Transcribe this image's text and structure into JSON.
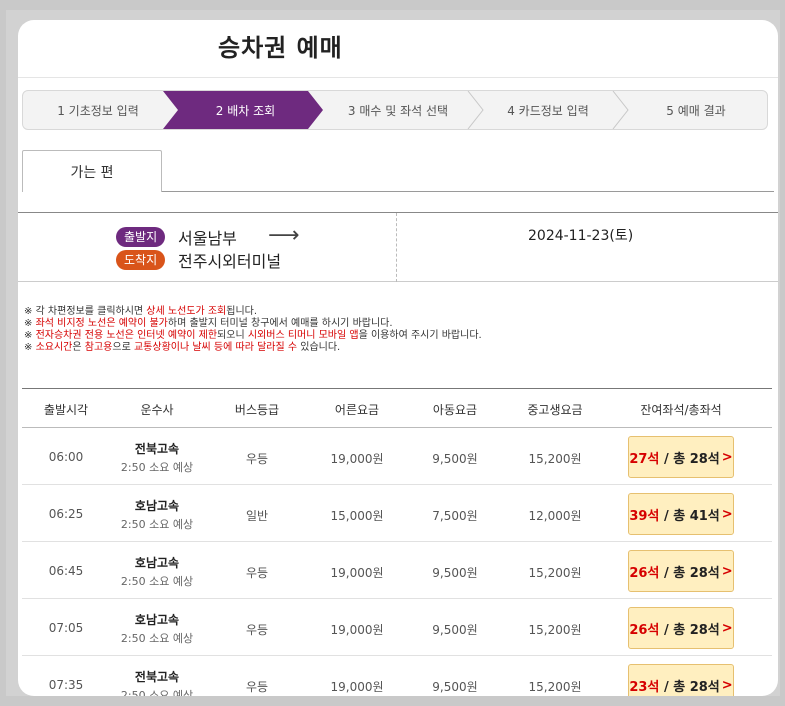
{
  "page": {
    "title": "승차권 예매"
  },
  "steps": [
    {
      "label": "1 기초정보 입력",
      "active": false
    },
    {
      "label": "2 배차 조회",
      "active": true
    },
    {
      "label": "3 매수 및 좌석 선택",
      "active": false
    },
    {
      "label": "4 카드정보 입력",
      "active": false
    },
    {
      "label": "5 예매 결과",
      "active": false
    }
  ],
  "tab": {
    "label": "가는 편"
  },
  "route": {
    "departure_badge": "출발지",
    "departure": "서울남부",
    "arrival_badge": "도착지",
    "arrival": "전주시외터미널",
    "arrow": "⟶",
    "date": "2024-11-23(토)"
  },
  "notes": [
    {
      "parts": [
        "※ 각 차편정보를 클릭하시면 ",
        "상세 노선도가 조회",
        "됩니다."
      ]
    },
    {
      "parts": [
        "※ ",
        "좌석 비지정 노선은 예약이 불가",
        "하며 출발지 터미널 창구에서 예매를 하시기 바랍니다."
      ]
    },
    {
      "parts": [
        "※ ",
        "전자승차권 전용 노선은 인터넷 예약이 제한",
        "되오니 ",
        "시외버스 티머니 모바일 앱",
        "을 이용하여 주시기 바랍니다."
      ]
    },
    {
      "parts": [
        "※ ",
        "소요시간",
        "은 ",
        "참고용",
        "으로 ",
        "교통상황이나 날씨 등에 따라 달라질 수",
        " 있습니다."
      ]
    }
  ],
  "table": {
    "headers": [
      "출발시각",
      "운수사",
      "버스등급",
      "어른요금",
      "아동요금",
      "중고생요금",
      "잔여좌석/총좌석"
    ],
    "rows": [
      {
        "time": "06:00",
        "company": "전북고속",
        "duration": "2:50 소요 예상",
        "grade": "우등",
        "adult": "19,000원",
        "child": "9,500원",
        "youth": "15,200원",
        "seats_avail": "27석",
        "seats_total": "/ 총 28석",
        "chev": ">"
      },
      {
        "time": "06:25",
        "company": "호남고속",
        "duration": "2:50 소요 예상",
        "grade": "일반",
        "adult": "15,000원",
        "child": "7,500원",
        "youth": "12,000원",
        "seats_avail": "39석",
        "seats_total": "/ 총 41석",
        "chev": ">"
      },
      {
        "time": "06:45",
        "company": "호남고속",
        "duration": "2:50 소요 예상",
        "grade": "우등",
        "adult": "19,000원",
        "child": "9,500원",
        "youth": "15,200원",
        "seats_avail": "26석",
        "seats_total": "/ 총 28석",
        "chev": ">"
      },
      {
        "time": "07:05",
        "company": "호남고속",
        "duration": "2:50 소요 예상",
        "grade": "우등",
        "adult": "19,000원",
        "child": "9,500원",
        "youth": "15,200원",
        "seats_avail": "26석",
        "seats_total": "/ 총 28석",
        "chev": ">"
      },
      {
        "time": "07:35",
        "company": "전북고속",
        "duration": "2:50 소요 예상",
        "grade": "우등",
        "adult": "19,000원",
        "child": "9,500원",
        "youth": "15,200원",
        "seats_avail": "23석",
        "seats_total": "/ 총 28석",
        "chev": ">"
      }
    ]
  },
  "colors": {
    "active_step": "#6e2a7f",
    "departure_badge": "#6e2a7f",
    "arrival_badge": "#d9541a",
    "seat_button_bg": "#ffefc0",
    "highlight_red": "#d60000"
  }
}
